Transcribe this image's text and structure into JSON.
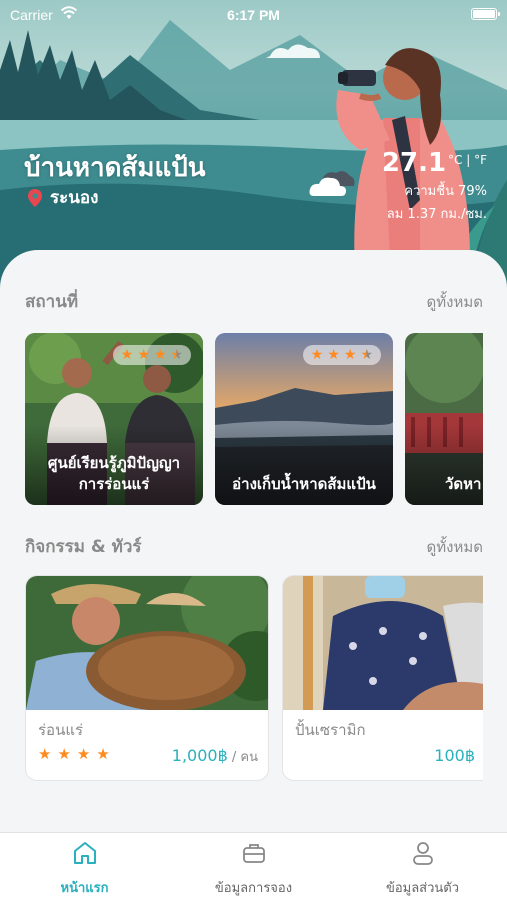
{
  "status_bar": {
    "carrier": "Carrier",
    "time": "6:17 PM"
  },
  "hero": {
    "title": "บ้านหาดส้มแป้น",
    "location": "ระนอง",
    "weather": {
      "temperature": "27.1",
      "units": "°C | °F",
      "humidity": "ความชื้น 79%",
      "wind": "ลม 1.37 กม./ซม."
    }
  },
  "places_section": {
    "title": "สถานที่",
    "see_all": "ดูทั้งหมด",
    "items": [
      {
        "name_line1": "ศูนย์เรียนรู้ภูมิปัญญา",
        "name_line2": "การร่อนแร่",
        "rating": 3.5
      },
      {
        "name_line1": "อ่างเก็บน้ำหาดส้มแป้น",
        "name_line2": "",
        "rating": 3.5
      },
      {
        "name_line1": "วัดหา",
        "name_line2": "",
        "rating": null
      }
    ]
  },
  "activities_section": {
    "title": "กิจกรรม & ทัวร์",
    "see_all": "ดูทั้งหมด",
    "items": [
      {
        "name": "ร่อนแร่",
        "rating": 4,
        "price": "1,000฿",
        "price_unit": " / คน"
      },
      {
        "name": "ปั้นเซรามิก",
        "rating": null,
        "price": "100฿",
        "price_unit": ""
      }
    ]
  },
  "tab_bar": {
    "tabs": [
      {
        "label": "หน้าแรก",
        "icon": "home-icon",
        "active": true
      },
      {
        "label": "ข้อมูลการจอง",
        "icon": "briefcase-icon",
        "active": false
      },
      {
        "label": "ข้อมูลส่วนตัว",
        "icon": "user-icon",
        "active": false
      }
    ]
  },
  "colors": {
    "accent": "#2bb0bd",
    "star": "#ff8a1f",
    "pin": "#e8474f"
  }
}
